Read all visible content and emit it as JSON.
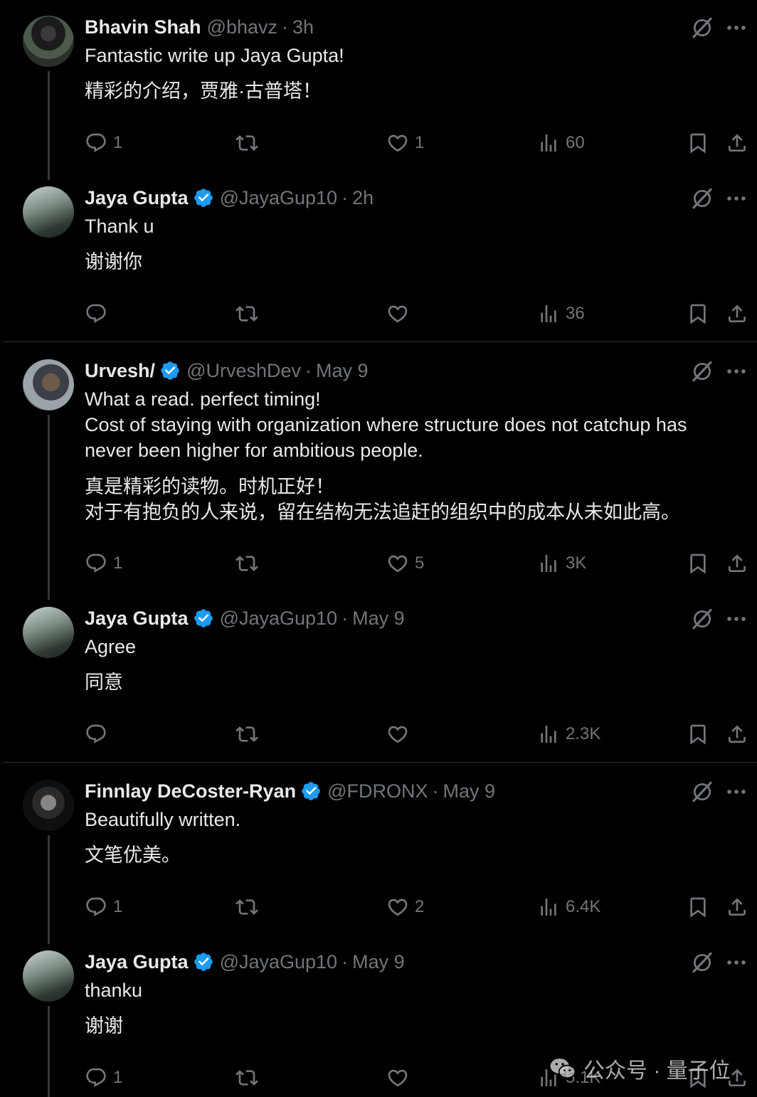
{
  "colors": {
    "background": "#000000",
    "text": "#e7e9ea",
    "secondary": "#71767b",
    "verified": "#1d9bf0",
    "divider": "#2f3336"
  },
  "tweets": [
    {
      "name": "Bhavin Shah",
      "handle": "@bhavz",
      "sep": "·",
      "time": "3h",
      "verified": false,
      "text": "Fantastic write up Jaya Gupta!",
      "translation": "精彩的介绍，贾雅·古普塔！",
      "replies": "1",
      "reposts": "",
      "likes": "1",
      "views": "60"
    },
    {
      "name": "Jaya Gupta",
      "handle": "@JayaGup10",
      "sep": "·",
      "time": "2h",
      "verified": true,
      "text": "Thank u",
      "translation": "谢谢你",
      "replies": "",
      "reposts": "",
      "likes": "",
      "views": "36"
    },
    {
      "name": "Urvesh/",
      "handle": "@UrveshDev",
      "sep": "·",
      "time": "May 9",
      "verified": true,
      "text_lines": [
        "What a read. perfect timing!",
        "Cost of staying with organization where structure does not catchup has",
        "never been higher for ambitious people."
      ],
      "translation_lines": [
        "真是精彩的读物。时机正好！",
        "对于有抱负的人来说，留在结构无法追赶的组织中的成本从未如此高。"
      ],
      "replies": "1",
      "reposts": "",
      "likes": "5",
      "views": "3K"
    },
    {
      "name": "Jaya Gupta",
      "handle": "@JayaGup10",
      "sep": "·",
      "time": "May 9",
      "verified": true,
      "text": "Agree",
      "translation": "同意",
      "replies": "",
      "reposts": "",
      "likes": "",
      "views": "2.3K"
    },
    {
      "name": "Finnlay DeCoster-Ryan",
      "handle": "@FDRONX",
      "sep": "·",
      "time": "May 9",
      "verified": true,
      "text": "Beautifully written.",
      "translation": "文笔优美。",
      "replies": "1",
      "reposts": "",
      "likes": "2",
      "views": "6.4K"
    },
    {
      "name": "Jaya Gupta",
      "handle": "@JayaGup10",
      "sep": "·",
      "time": "May 9",
      "verified": true,
      "text": "thanku",
      "translation": "谢谢",
      "replies": "1",
      "reposts": "",
      "likes": "",
      "views": "5.1K"
    }
  ],
  "watermark": {
    "text": "公众号 · 量子位",
    "icon": "wechat-icon"
  }
}
